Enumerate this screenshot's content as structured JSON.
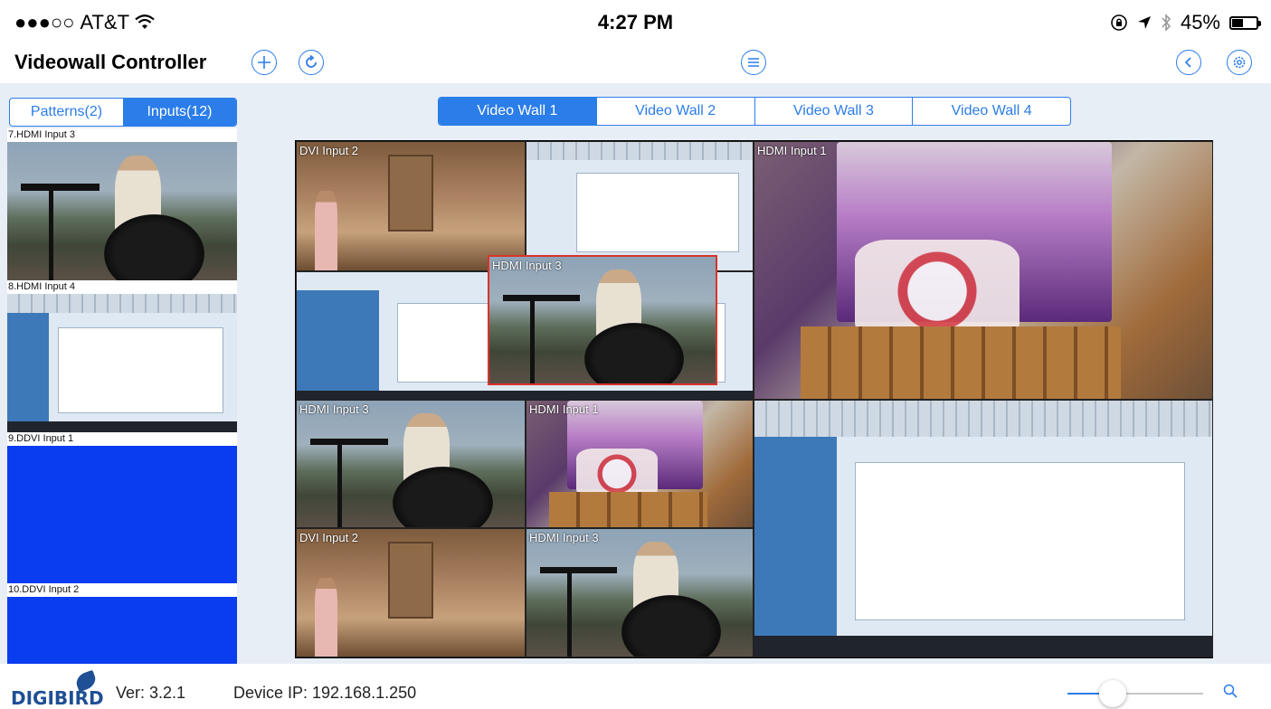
{
  "status_bar": {
    "carrier": "AT&T",
    "signal": "●●●○○",
    "time": "4:27 PM",
    "battery": "45%",
    "battery_level": 0.45
  },
  "nav": {
    "title": "Videowall Controller",
    "add_icon": "plus-circle-icon",
    "refresh_icon": "refresh-circle-icon",
    "menu_icon": "list-circle-icon",
    "back_icon": "chevron-left-circle-icon",
    "settings_icon": "gear-circle-icon"
  },
  "left_tabs": {
    "patterns": "Patterns(2)",
    "inputs": "Inputs(12)",
    "active": "inputs"
  },
  "inputs": [
    {
      "label": "7.HDMI Input 3",
      "scene": "mountain"
    },
    {
      "label": "8.HDMI Input 4",
      "scene": "screen"
    },
    {
      "label": "9.DDVI Input 1",
      "scene": "blue"
    },
    {
      "label": "10.DDVI Input 2",
      "scene": "blue"
    }
  ],
  "wall_tabs": [
    "Video Wall 1",
    "Video Wall 2",
    "Video Wall 3",
    "Video Wall 4"
  ],
  "wall_active_tab": 0,
  "wall_windows": [
    {
      "label": "DVI Input 2",
      "scene": "room"
    },
    {
      "label": "",
      "scene": "screen"
    },
    {
      "label": "",
      "scene": "screen"
    },
    {
      "label": "HDMI Input 3",
      "scene": "mountain",
      "selected": true
    },
    {
      "label": "HDMI Input 1",
      "scene": "cookies"
    },
    {
      "label": "HDMI Input 3",
      "scene": "mountain"
    },
    {
      "label": "HDMI Input 1",
      "scene": "cookies"
    },
    {
      "label": "DVI Input 2",
      "scene": "room"
    },
    {
      "label": "HDMI Input 3",
      "scene": "mountain"
    },
    {
      "label": "",
      "scene": "screen"
    }
  ],
  "footer": {
    "logo_text": "DIGIBIRD",
    "version": "Ver: 3.2.1",
    "device_ip": "Device IP: 192.168.1.250",
    "zoom_level": 0.33,
    "zoom_icon": "search-icon"
  },
  "colors": {
    "accent": "#2b7de9",
    "selected_border": "#d8342b",
    "blue_input": "#0a3cf0",
    "panel_bg": "#e8eef5"
  }
}
